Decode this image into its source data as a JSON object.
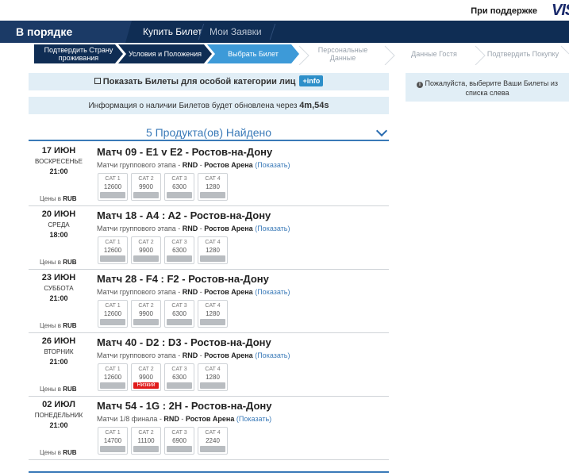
{
  "header": {
    "sponsor_text": "При поддержке",
    "logo_text": "VISA"
  },
  "nav": {
    "brand": "В порядке очереди",
    "links": [
      "Купить Билет",
      "Мои Заявки"
    ]
  },
  "steps": [
    {
      "line1": "Подтвердить Страну",
      "line2": "проживания",
      "state": "done"
    },
    {
      "line1": "Условия и Положения",
      "line2": "",
      "state": "done"
    },
    {
      "line1": "Выбрать Билет",
      "line2": "",
      "state": "current"
    },
    {
      "line1": "Персональные",
      "line2": "Данные",
      "state": "future"
    },
    {
      "line1": "Данные Гостя",
      "line2": "",
      "state": "future"
    },
    {
      "line1": "Подтвердить Покупку",
      "line2": "",
      "state": "future"
    }
  ],
  "special_category": {
    "label": "Показать Билеты для особой категории лиц",
    "info_button": "+info"
  },
  "refresh_notice": {
    "text": "Информация о наличии Билетов будет обновлена через",
    "time": "4m,54s"
  },
  "results_title": "5 Продукта(ов) Найдено",
  "right_panel": {
    "line1": "Пожалуйста, выберите Ваши Билеты из",
    "line2": "списка слева"
  },
  "prices_label": "Цены в",
  "currency": "RUB",
  "show_label": "(Показать)",
  "venue_prefix": "RND",
  "venue_name": "Ростов Арена",
  "matches": [
    {
      "day": "17 ИЮН",
      "weekday": "ВОСКРЕСЕНЬЕ",
      "time": "21:00",
      "title": "Матч 09 - E1 v E2 - Ростов-на-Дону",
      "stage": "Матчи группового этапа",
      "cats": [
        {
          "name": "CAT 1",
          "price": "12600",
          "status": ""
        },
        {
          "name": "CAT 2",
          "price": "9900",
          "status": ""
        },
        {
          "name": "CAT 3",
          "price": "6300",
          "status": ""
        },
        {
          "name": "CAT 4",
          "price": "1280",
          "status": ""
        }
      ]
    },
    {
      "day": "20 ИЮН",
      "weekday": "СРЕДА",
      "time": "18:00",
      "title": "Матч 18 - A4 : A2 - Ростов-на-Дону",
      "stage": "Матчи группового этапа",
      "cats": [
        {
          "name": "CAT 1",
          "price": "12600",
          "status": ""
        },
        {
          "name": "CAT 2",
          "price": "9900",
          "status": ""
        },
        {
          "name": "CAT 3",
          "price": "6300",
          "status": ""
        },
        {
          "name": "CAT 4",
          "price": "1280",
          "status": ""
        }
      ]
    },
    {
      "day": "23 ИЮН",
      "weekday": "СУББОТА",
      "time": "21:00",
      "title": "Матч 28 - F4 : F2 - Ростов-на-Дону",
      "stage": "Матчи группового этапа",
      "cats": [
        {
          "name": "CAT 1",
          "price": "12600",
          "status": ""
        },
        {
          "name": "CAT 2",
          "price": "9900",
          "status": ""
        },
        {
          "name": "CAT 3",
          "price": "6300",
          "status": ""
        },
        {
          "name": "CAT 4",
          "price": "1280",
          "status": ""
        }
      ]
    },
    {
      "day": "26 ИЮН",
      "weekday": "ВТОРНИК",
      "time": "21:00",
      "title": "Матч 40 - D2 : D3 - Ростов-на-Дону",
      "stage": "Матчи группового этапа",
      "cats": [
        {
          "name": "CAT 1",
          "price": "12600",
          "status": ""
        },
        {
          "name": "CAT 2",
          "price": "9900",
          "status": "Низкий"
        },
        {
          "name": "CAT 3",
          "price": "6300",
          "status": ""
        },
        {
          "name": "CAT 4",
          "price": "1280",
          "status": ""
        }
      ]
    },
    {
      "day": "02 ИЮЛ",
      "weekday": "ПОНЕДЕЛЬНИК",
      "time": "21:00",
      "title": "Матч 54 - 1G : 2H - Ростов-на-Дону",
      "stage": "Матчи 1/8 финала",
      "cats": [
        {
          "name": "CAT 1",
          "price": "14700",
          "status": ""
        },
        {
          "name": "CAT 2",
          "price": "11100",
          "status": ""
        },
        {
          "name": "CAT 3",
          "price": "6900",
          "status": ""
        },
        {
          "name": "CAT 4",
          "price": "2240",
          "status": ""
        }
      ]
    }
  ],
  "colors": {
    "navy": "#0f2d54",
    "accent_blue": "#3d9ad8",
    "info_bg": "#e1eef6",
    "low_availability": "#e01b1b"
  }
}
